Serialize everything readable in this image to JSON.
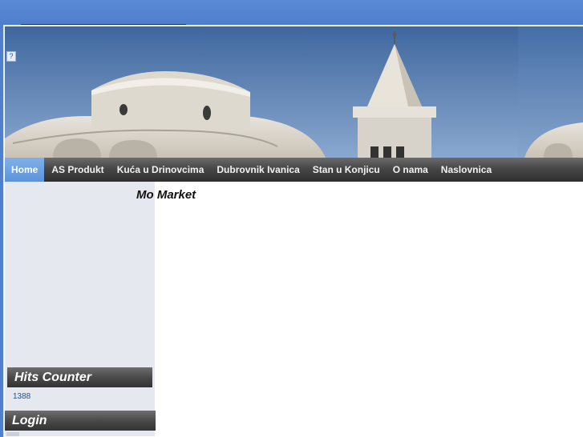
{
  "header": {
    "banner_image": "church-bell-tower-banner",
    "broken_image_glyph": "?"
  },
  "nav": {
    "items": [
      {
        "label": "Home",
        "active": true
      },
      {
        "label": "AS Produkt"
      },
      {
        "label": "Kuća u Drinovcima"
      },
      {
        "label": "Dubrovnik Ivanica"
      },
      {
        "label": "Stan u Konjicu"
      },
      {
        "label": "O nama"
      },
      {
        "label": "Naslovnica"
      }
    ]
  },
  "main": {
    "title": "Mo Market"
  },
  "sidebar": {
    "hits_counter": {
      "title": "Hits Counter",
      "value": "1388"
    },
    "login": {
      "title": "Login"
    }
  },
  "colors": {
    "page_background": "#4f80cf",
    "nav_active": "#6aa0e2",
    "nav_bar": "#474747",
    "sidebar": "#e5e8ee"
  }
}
